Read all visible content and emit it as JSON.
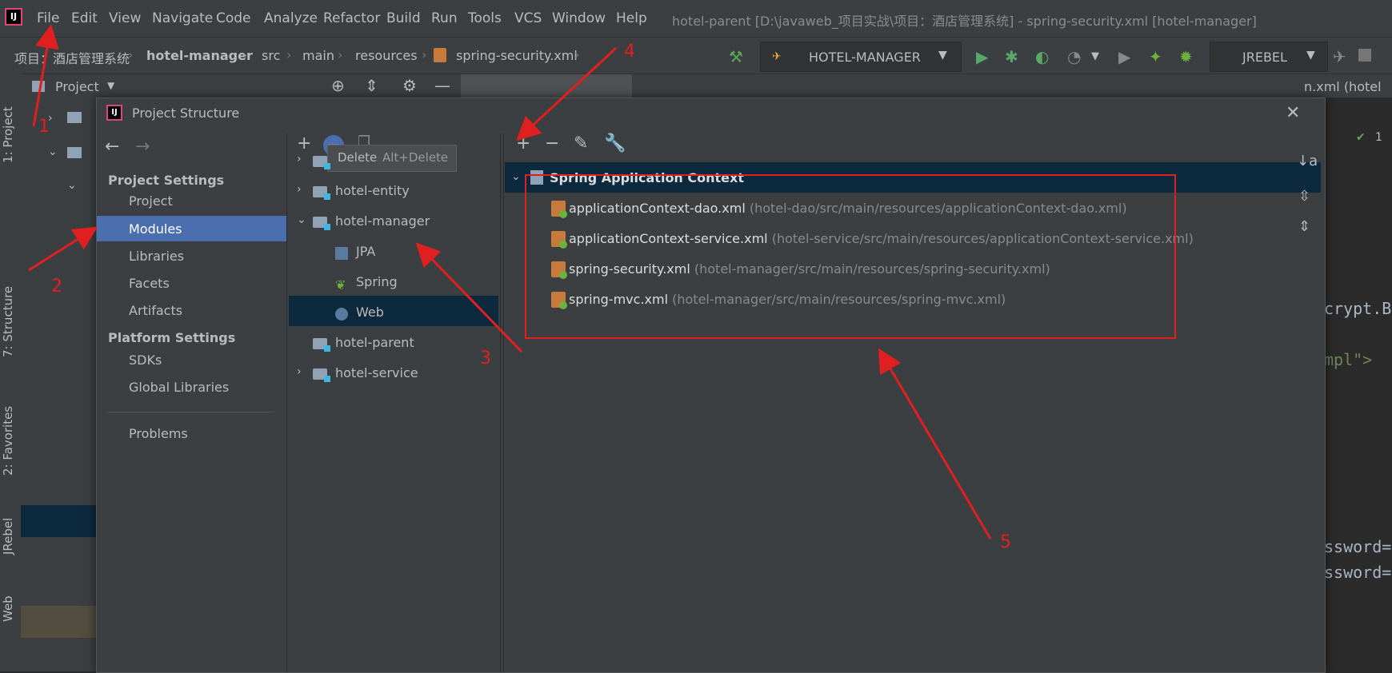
{
  "menubar": {
    "items": [
      "File",
      "Edit",
      "View",
      "Navigate",
      "Code",
      "Analyze",
      "Refactor",
      "Build",
      "Run",
      "Tools",
      "VCS",
      "Window",
      "Help"
    ],
    "window_title": "hotel-parent [D:\\javaweb_项目实战\\项目：酒店管理系统] - spring-security.xml [hotel-manager]"
  },
  "navbar": {
    "breadcrumbs": [
      "项目：酒店管理系统",
      "hotel-manager",
      "src",
      "main",
      "resources",
      "spring-security.xml"
    ],
    "run_config": "HOTEL-MANAGER",
    "jrebel": "JREBEL"
  },
  "tool_window": {
    "title": "Project"
  },
  "editor_tabs": [
    "n.xml (hotel"
  ],
  "left_tabs": [
    "1: Project",
    "7: Structure",
    "2: Favorites",
    "JRebel",
    "Web"
  ],
  "dialog": {
    "title": "Project Structure",
    "close_icon": "close-icon",
    "sections": [
      {
        "header": "Project Settings",
        "items": [
          "Project",
          "Modules",
          "Libraries",
          "Facets",
          "Artifacts"
        ]
      },
      {
        "header": "Platform Settings",
        "items": [
          "SDKs",
          "Global Libraries"
        ]
      },
      {
        "header": "",
        "items": [
          "Problems"
        ]
      }
    ],
    "selected_side_item": "Modules",
    "tooltip": {
      "label": "Delete",
      "shortcut": "Alt+Delete"
    },
    "modules": {
      "items": [
        "hotel-entity",
        "hotel-manager",
        "JPA",
        "Spring",
        "Web",
        "hotel-parent",
        "hotel-service"
      ],
      "selected": "Spring"
    },
    "context": {
      "header": "Spring Application Context",
      "files": [
        {
          "name": "applicationContext-dao.xml",
          "path": "(hotel-dao/src/main/resources/applicationContext-dao.xml)"
        },
        {
          "name": "applicationContext-service.xml",
          "path": "(hotel-service/src/main/resources/applicationContext-service.xml)"
        },
        {
          "name": "spring-security.xml",
          "path": "(hotel-manager/src/main/resources/spring-security.xml)"
        },
        {
          "name": "spring-mvc.xml",
          "path": "(hotel-manager/src/main/resources/spring-mvc.xml)"
        }
      ]
    }
  },
  "editor_fragments": [
    "crypt.B",
    "mpl\">",
    "ssword=",
    "ssword="
  ],
  "gutter_badge": "1",
  "annotations": [
    "1",
    "2",
    "3",
    "4",
    "5"
  ],
  "colors": {
    "selection": "#4b6eaf",
    "annotation": "#e02020",
    "tree_selection": "#0d293e"
  }
}
